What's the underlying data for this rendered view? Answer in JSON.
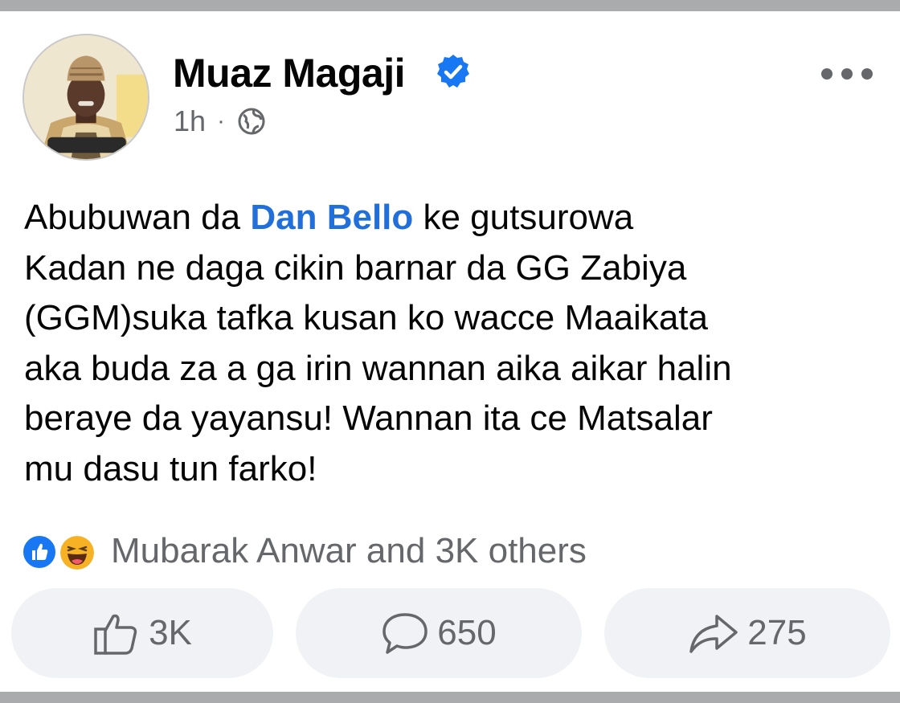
{
  "post": {
    "author": "Muaz Magaji",
    "verified_icon": "verified-badge-icon",
    "timestamp": "1h",
    "separator": "·",
    "audience_icon": "globe-icon",
    "more_icon": "more-options-icon",
    "text_lines": [
      {
        "before": "Abubuwan da ",
        "mention": "Dan Bello",
        "after": " ke gutsurowa"
      },
      {
        "text": "Kadan ne daga cikin barnar da GG Zabiya"
      },
      {
        "text": "(GGM)suka tafka kusan ko wacce Maaikata"
      },
      {
        "text": "aka buda za a ga irin wannan aika aikar halin"
      },
      {
        "text": "beraye da yayansu! Wannan ita ce Matsalar"
      },
      {
        "text": "mu dasu tun farko!"
      }
    ]
  },
  "reactions": {
    "icons": [
      "like-reaction-icon",
      "haha-reaction-icon"
    ],
    "summary": "Mubarak Anwar and 3K others"
  },
  "actions": {
    "like_count": "3K",
    "comment_count": "650",
    "share_count": "275"
  },
  "colors": {
    "mention": "#216fdb",
    "verified": "#1877f2",
    "muted": "#65676b",
    "button_bg": "#f0f2f5",
    "frame_bar": "#a9abad"
  }
}
